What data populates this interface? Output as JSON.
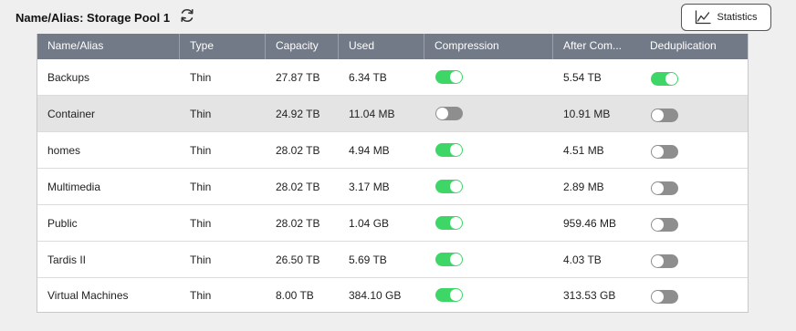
{
  "panel": {
    "title": "Name/Alias: Storage Pool 1",
    "refresh_icon": "refresh-icon"
  },
  "toolbar": {
    "statistics_label": "Statistics",
    "statistics_icon": "line-chart-icon"
  },
  "table": {
    "columns": [
      "Name/Alias",
      "Type",
      "Capacity",
      "Used",
      "Compression",
      "After Com...",
      "Deduplication"
    ],
    "rows": [
      {
        "name": "Backups",
        "type": "Thin",
        "capacity": "27.87 TB",
        "used": "6.34 TB",
        "compression": true,
        "after_compression": "5.54 TB",
        "deduplication": true,
        "selected": false
      },
      {
        "name": "Container",
        "type": "Thin",
        "capacity": "24.92 TB",
        "used": "11.04 MB",
        "compression": false,
        "after_compression": "10.91 MB",
        "deduplication": false,
        "selected": true
      },
      {
        "name": "homes",
        "type": "Thin",
        "capacity": "28.02 TB",
        "used": "4.94 MB",
        "compression": true,
        "after_compression": "4.51 MB",
        "deduplication": false,
        "selected": false
      },
      {
        "name": "Multimedia",
        "type": "Thin",
        "capacity": "28.02 TB",
        "used": "3.17 MB",
        "compression": true,
        "after_compression": "2.89 MB",
        "deduplication": false,
        "selected": false
      },
      {
        "name": "Public",
        "type": "Thin",
        "capacity": "28.02 TB",
        "used": "1.04 GB",
        "compression": true,
        "after_compression": "959.46 MB",
        "deduplication": false,
        "selected": false
      },
      {
        "name": "Tardis II",
        "type": "Thin",
        "capacity": "26.50 TB",
        "used": "5.69 TB",
        "compression": true,
        "after_compression": "4.03 TB",
        "deduplication": false,
        "selected": false
      },
      {
        "name": "Virtual Machines",
        "type": "Thin",
        "capacity": "8.00 TB",
        "used": "384.10 GB",
        "compression": true,
        "after_compression": "313.53 GB",
        "deduplication": false,
        "selected": false
      }
    ]
  },
  "colors": {
    "header_bg": "#727987",
    "toggle_on": "#3dd667",
    "toggle_off": "#8e8e8e",
    "selected_row": "#e4e4e4"
  }
}
